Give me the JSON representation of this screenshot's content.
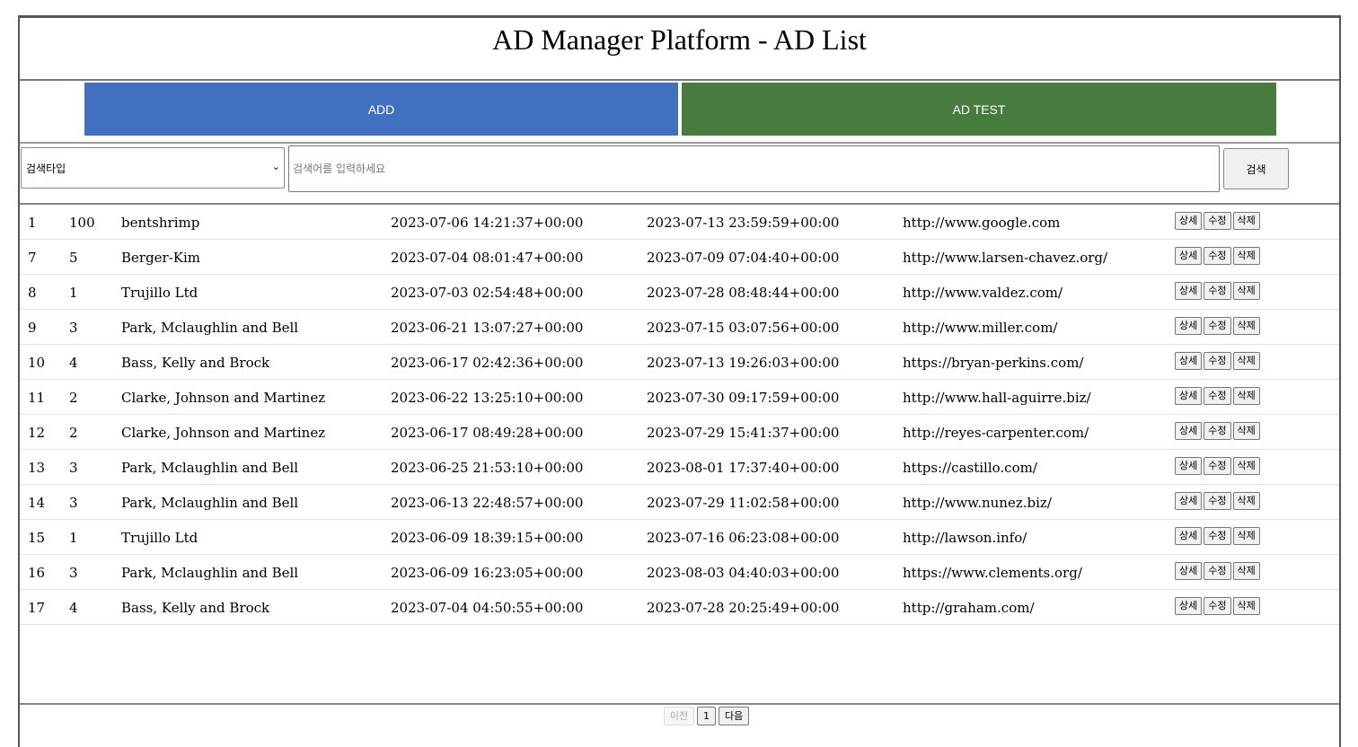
{
  "header": {
    "title": "AD Manager Platform - AD List"
  },
  "actions": {
    "add_label": "ADD",
    "test_label": "AD TEST",
    "add_color": "#4170bf",
    "test_color": "#487b3f"
  },
  "search": {
    "type_value": "검색타입",
    "placeholder": "검색어를 입력하세요",
    "button_label": "검색"
  },
  "row_actions": {
    "detail": "상세",
    "edit": "수정",
    "delete": "삭제"
  },
  "rows": [
    {
      "id": "1",
      "num": "100",
      "name": "bentshrimp",
      "start": "2023-07-06 14:21:37+00:00",
      "end": "2023-07-13 23:59:59+00:00",
      "url": "http://www.google.com"
    },
    {
      "id": "7",
      "num": "5",
      "name": "Berger-Kim",
      "start": "2023-07-04 08:01:47+00:00",
      "end": "2023-07-09 07:04:40+00:00",
      "url": "http://www.larsen-chavez.org/"
    },
    {
      "id": "8",
      "num": "1",
      "name": "Trujillo Ltd",
      "start": "2023-07-03 02:54:48+00:00",
      "end": "2023-07-28 08:48:44+00:00",
      "url": "http://www.valdez.com/"
    },
    {
      "id": "9",
      "num": "3",
      "name": "Park, Mclaughlin and Bell",
      "start": "2023-06-21 13:07:27+00:00",
      "end": "2023-07-15 03:07:56+00:00",
      "url": "http://www.miller.com/"
    },
    {
      "id": "10",
      "num": "4",
      "name": "Bass, Kelly and Brock",
      "start": "2023-06-17 02:42:36+00:00",
      "end": "2023-07-13 19:26:03+00:00",
      "url": "https://bryan-perkins.com/"
    },
    {
      "id": "11",
      "num": "2",
      "name": "Clarke, Johnson and Martinez",
      "start": "2023-06-22 13:25:10+00:00",
      "end": "2023-07-30 09:17:59+00:00",
      "url": "http://www.hall-aguirre.biz/"
    },
    {
      "id": "12",
      "num": "2",
      "name": "Clarke, Johnson and Martinez",
      "start": "2023-06-17 08:49:28+00:00",
      "end": "2023-07-29 15:41:37+00:00",
      "url": "http://reyes-carpenter.com/"
    },
    {
      "id": "13",
      "num": "3",
      "name": "Park, Mclaughlin and Bell",
      "start": "2023-06-25 21:53:10+00:00",
      "end": "2023-08-01 17:37:40+00:00",
      "url": "https://castillo.com/"
    },
    {
      "id": "14",
      "num": "3",
      "name": "Park, Mclaughlin and Bell",
      "start": "2023-06-13 22:48:57+00:00",
      "end": "2023-07-29 11:02:58+00:00",
      "url": "http://www.nunez.biz/"
    },
    {
      "id": "15",
      "num": "1",
      "name": "Trujillo Ltd",
      "start": "2023-06-09 18:39:15+00:00",
      "end": "2023-07-16 06:23:08+00:00",
      "url": "http://lawson.info/"
    },
    {
      "id": "16",
      "num": "3",
      "name": "Park, Mclaughlin and Bell",
      "start": "2023-06-09 16:23:05+00:00",
      "end": "2023-08-03 04:40:03+00:00",
      "url": "https://www.clements.org/"
    },
    {
      "id": "17",
      "num": "4",
      "name": "Bass, Kelly and Brock",
      "start": "2023-07-04 04:50:55+00:00",
      "end": "2023-07-28 20:25:49+00:00",
      "url": "http://graham.com/"
    }
  ],
  "pagination": {
    "prev_label": "이전",
    "current_page": "1",
    "next_label": "다음"
  }
}
